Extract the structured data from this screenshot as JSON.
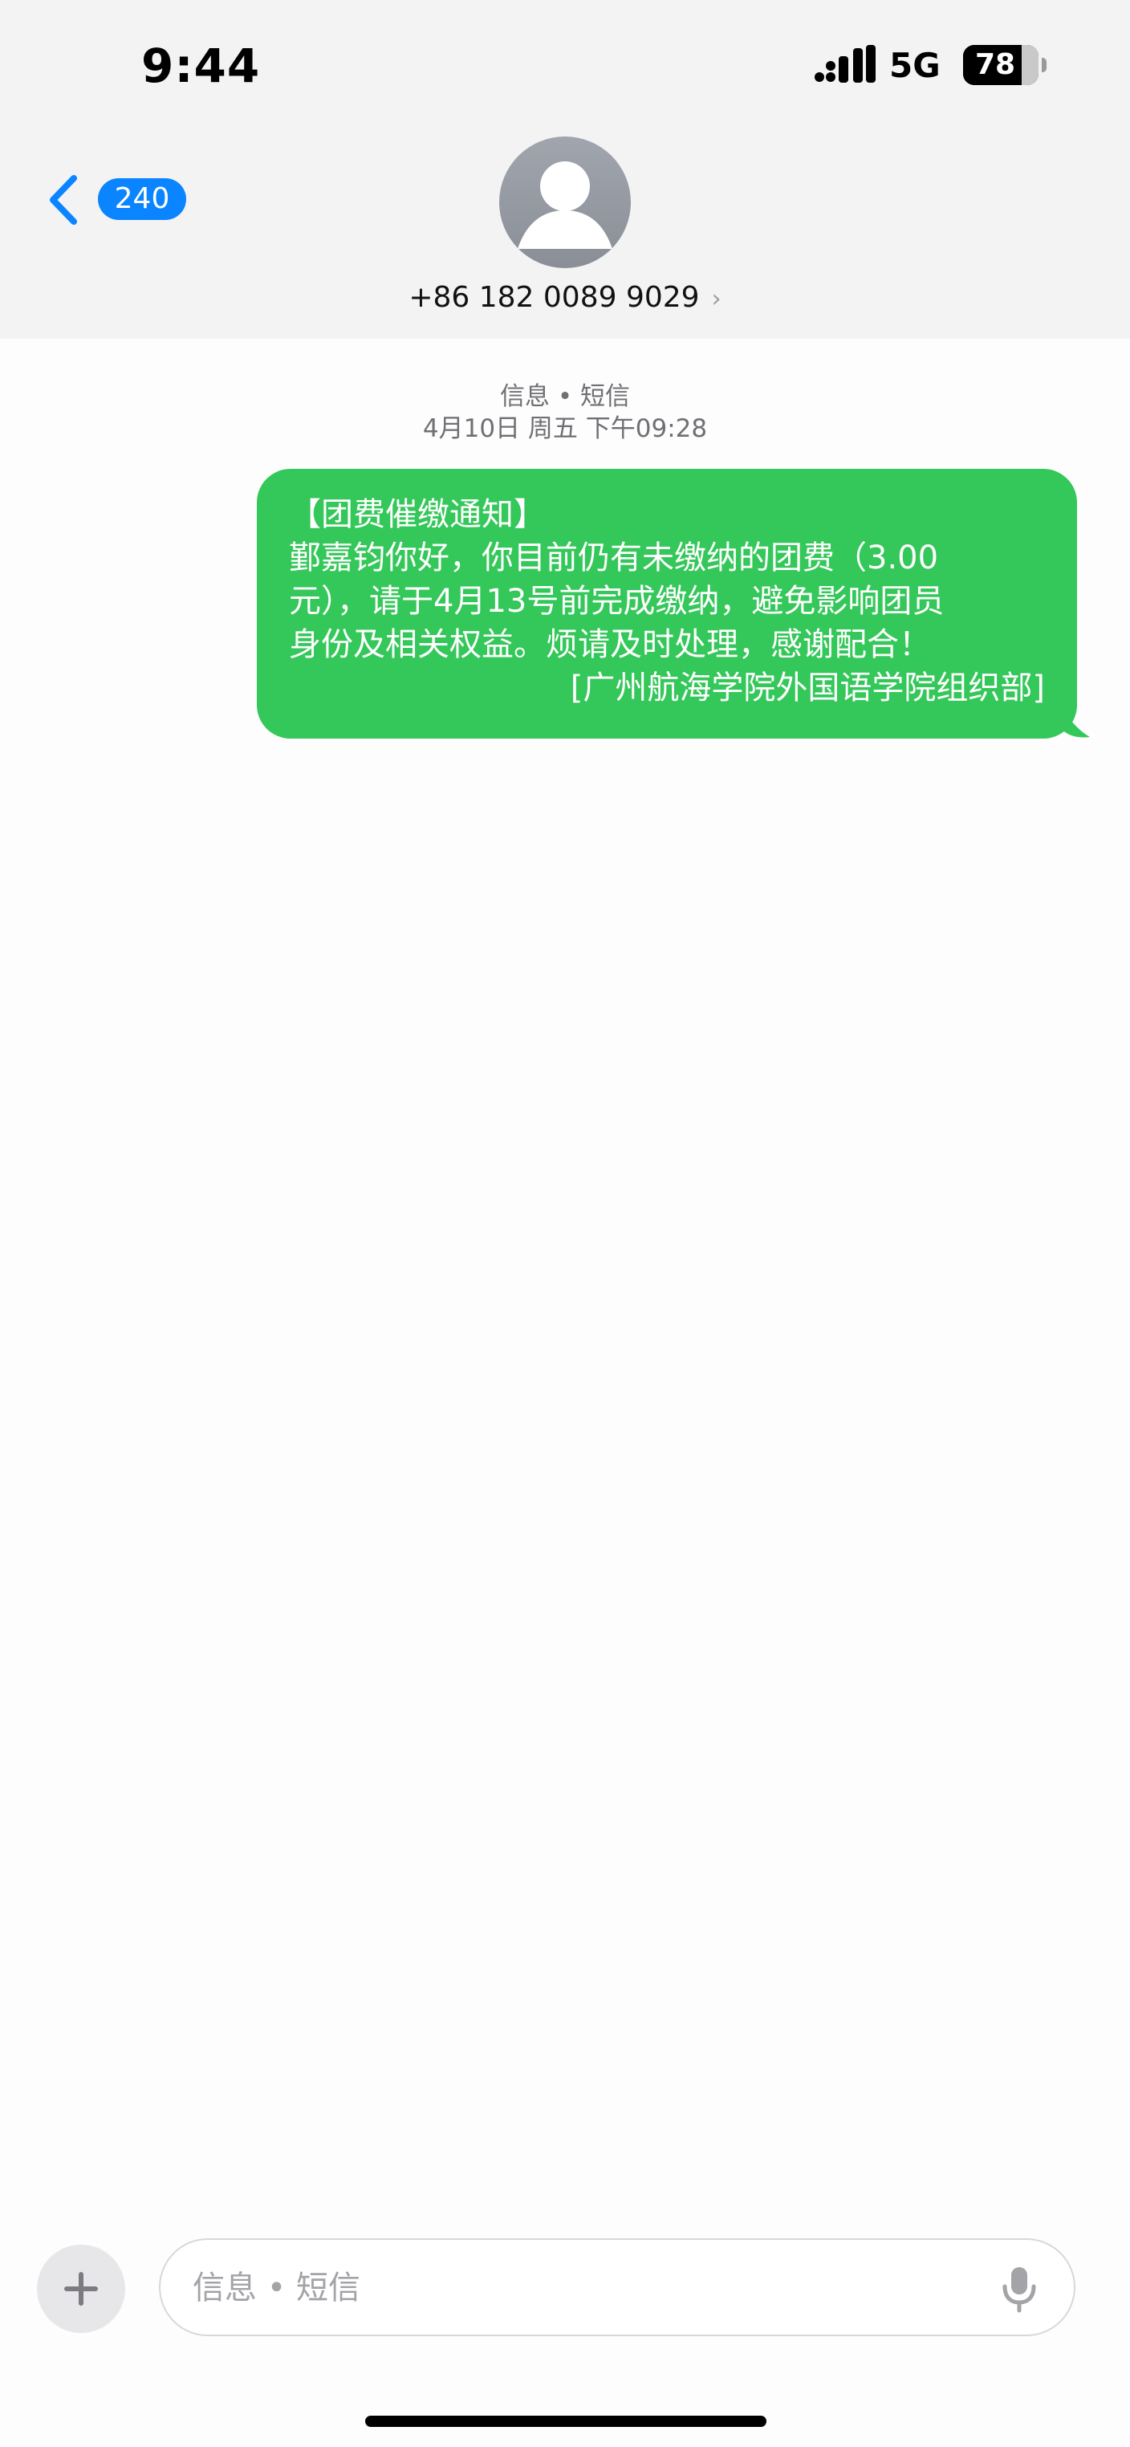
{
  "status_bar": {
    "time": "9:44",
    "network": "5G",
    "battery_level": "78"
  },
  "header": {
    "back_badge": "240",
    "contact_number": "+86 182 0089 9029",
    "contact_chevron": "›"
  },
  "thread": {
    "service_label": "信息 • 短信",
    "date_label": "4月10日 周五 下午09:28",
    "message": {
      "lines": [
        "【团费催缴通知】",
        "鄞嘉钧你好，你目前仍有未缴纳的团费（3.00",
        "元），请于4月13号前完成缴纳，避免影响团员",
        "身份及相关权益。烦请及时处理，感谢配合！"
      ],
      "signature": "[广州航海学院外国语学院组织部]"
    }
  },
  "composer": {
    "placeholder": "信息 • 短信"
  },
  "colors": {
    "bubble": "#34c759",
    "badge": "#0a84ff",
    "header_background": "#f3f3f3",
    "background": "#fdfdfd"
  },
  "icons": {
    "signal": "cellular-signal-icon",
    "battery": "battery-icon",
    "back": "chevron-left-icon",
    "avatar": "person-placeholder-icon",
    "add": "plus-icon",
    "mic": "microphone-icon"
  }
}
